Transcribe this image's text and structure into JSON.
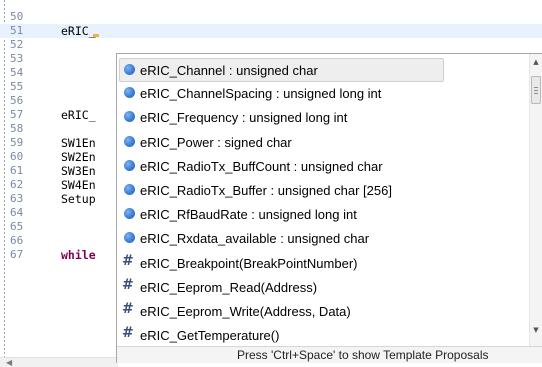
{
  "editor": {
    "lines": [
      {
        "num": "50",
        "code": ""
      },
      {
        "num": "51",
        "code": "eRIC_"
      },
      {
        "num": "52",
        "code": ""
      },
      {
        "num": "53",
        "code": ""
      },
      {
        "num": "54",
        "code": ""
      },
      {
        "num": "55",
        "code": ""
      },
      {
        "num": "56",
        "code": ""
      },
      {
        "num": "57",
        "code": "eRIC_"
      },
      {
        "num": "58",
        "code": ""
      },
      {
        "num": "59",
        "code": "SW1En"
      },
      {
        "num": "60",
        "code": "SW2En"
      },
      {
        "num": "61",
        "code": "SW3En"
      },
      {
        "num": "62",
        "code": "SW4En"
      },
      {
        "num": "63",
        "code": "Setup"
      },
      {
        "num": "64",
        "code": ""
      },
      {
        "num": "65",
        "code": ""
      },
      {
        "num": "66",
        "code": ""
      },
      {
        "num": "67",
        "code": "while"
      }
    ],
    "current_line": "51"
  },
  "completion": {
    "items": [
      {
        "icon": "field-dot-icon",
        "label": "eRIC_Channel : unsigned char",
        "selected": true
      },
      {
        "icon": "field-dot-icon",
        "label": "eRIC_ChannelSpacing : unsigned long int"
      },
      {
        "icon": "field-dot-icon",
        "label": "eRIC_Frequency : unsigned long int"
      },
      {
        "icon": "field-dot-icon",
        "label": "eRIC_Power : signed char"
      },
      {
        "icon": "field-dot-icon",
        "label": "eRIC_RadioTx_BuffCount : unsigned char"
      },
      {
        "icon": "field-dot-icon",
        "label": "eRIC_RadioTx_Buffer : unsigned char [256]"
      },
      {
        "icon": "field-dot-icon",
        "label": "eRIC_RfBaudRate : unsigned long int"
      },
      {
        "icon": "field-dot-icon",
        "label": "eRIC_Rxdata_available : unsigned char"
      },
      {
        "icon": "macro-hash-icon",
        "label": "eRIC_Breakpoint(BreakPointNumber)"
      },
      {
        "icon": "macro-hash-icon",
        "label": "eRIC_Eeprom_Read(Address)"
      },
      {
        "icon": "macro-hash-icon",
        "label": "eRIC_Eeprom_Write(Address, Data)"
      },
      {
        "icon": "macro-hash-icon",
        "label": "eRIC_GetTemperature()"
      }
    ],
    "status_text": "Press 'Ctrl+Space' to show Template Proposals",
    "hash_glyph": "#"
  },
  "colors": {
    "current_line_bg": "#e8f2fe",
    "line_number": "#7a8aa3",
    "keyword": "#7f0055",
    "field_icon": "#3b7fd3",
    "macro_icon": "#3a4f7a"
  }
}
